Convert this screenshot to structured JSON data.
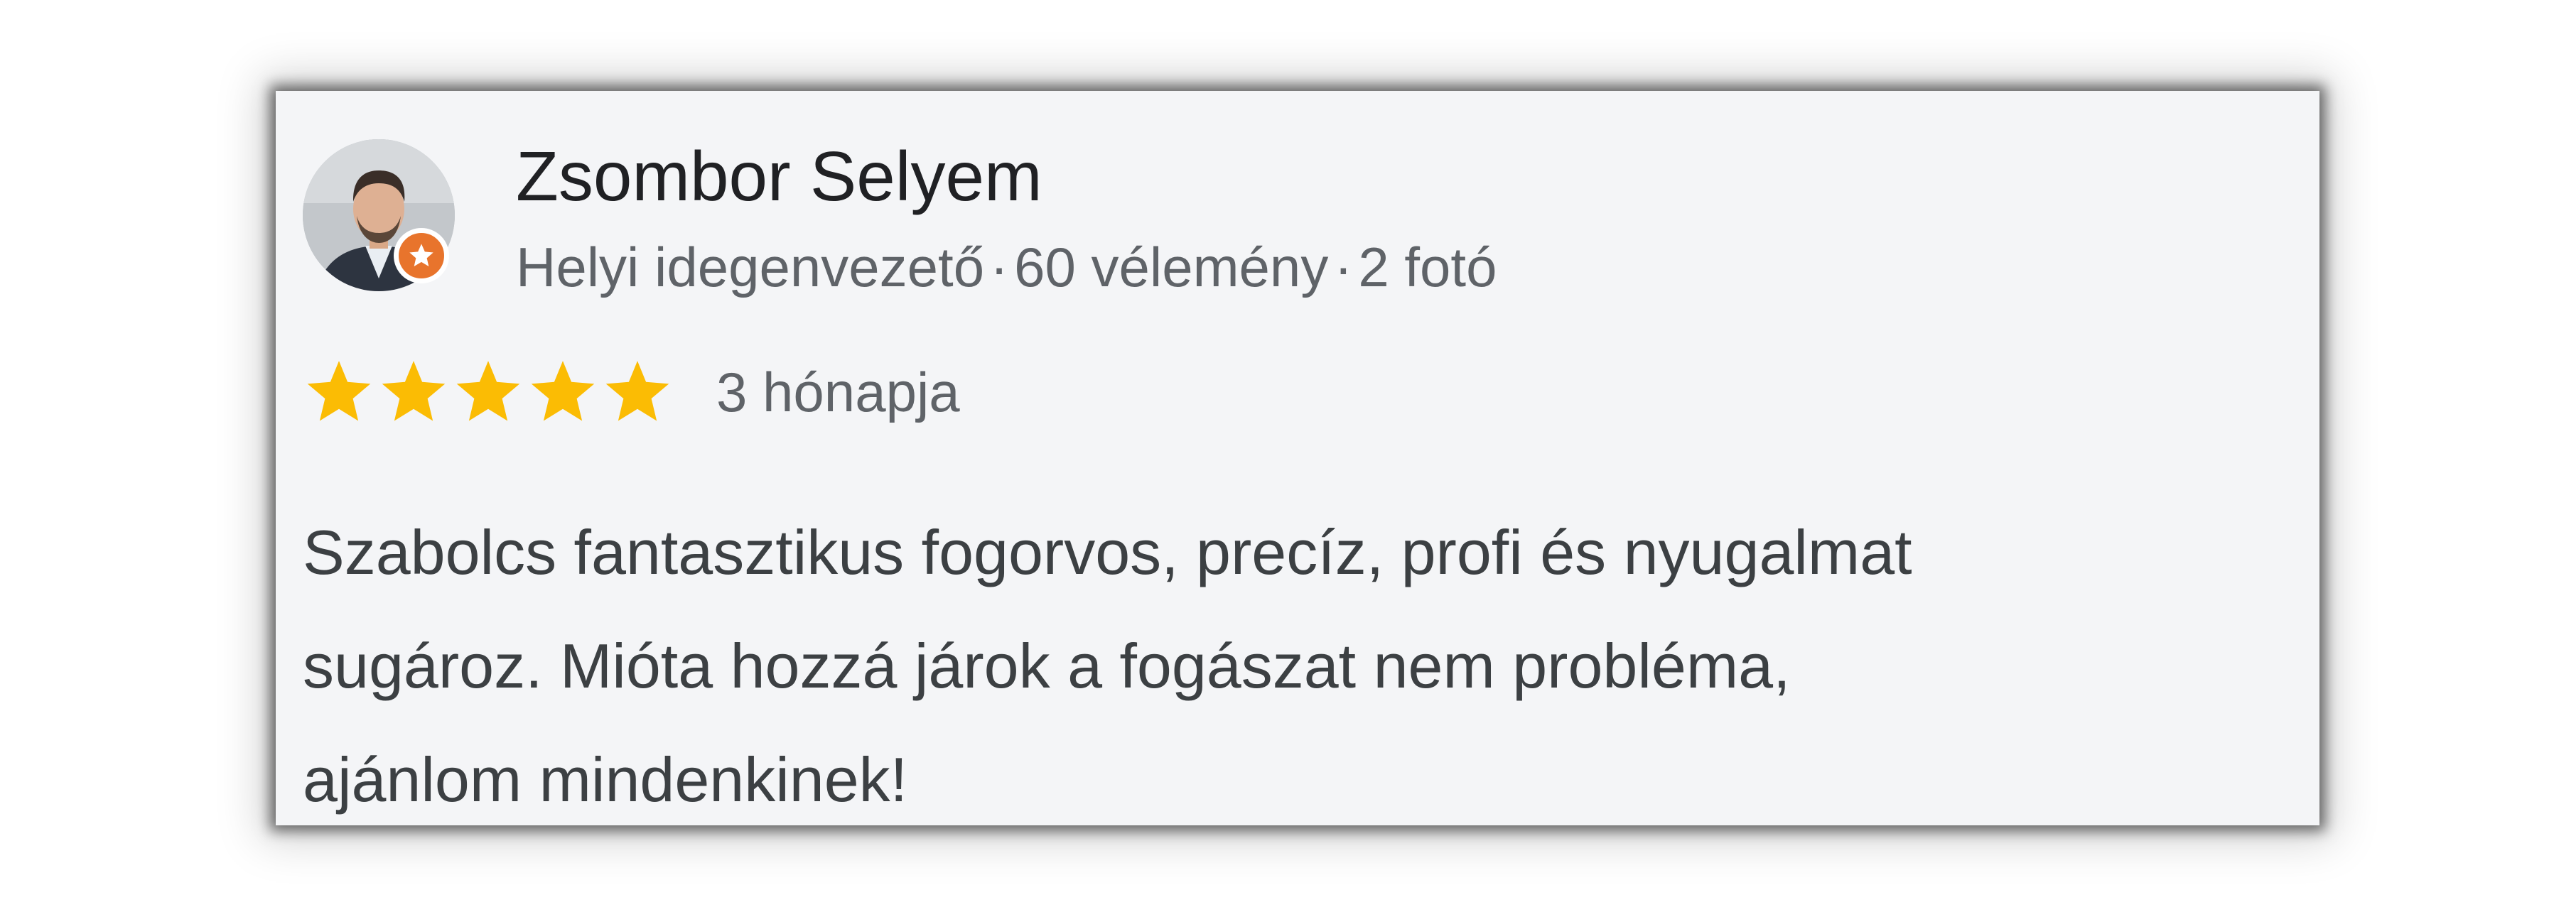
{
  "review": {
    "reviewer_name": "Zsombor Selyem",
    "reviewer_role": "Helyi idegenvezető",
    "separator": "·",
    "review_count": "60 vélemény",
    "photo_count": "2 fotó",
    "rating": 5,
    "rating_max": 5,
    "age": "3 hónapja",
    "text_lines": [
      "Szabolcs fantasztikus fogorvos, precíz, profi és nyugalmat",
      "sugároz. Mióta hozzá járok a fogászat nem probléma,",
      "ajánlom mindenkinek!"
    ]
  },
  "icons": {
    "avatar": "avatar-photo",
    "badge": "local-guide-star-icon",
    "star": "star-icon"
  },
  "colors": {
    "card_background": "#f4f5f7",
    "star_color": "#fbbc04",
    "badge_color": "#e8742c",
    "name_color": "#202124",
    "meta_color": "#5f6368",
    "text_color": "#3c4043"
  }
}
